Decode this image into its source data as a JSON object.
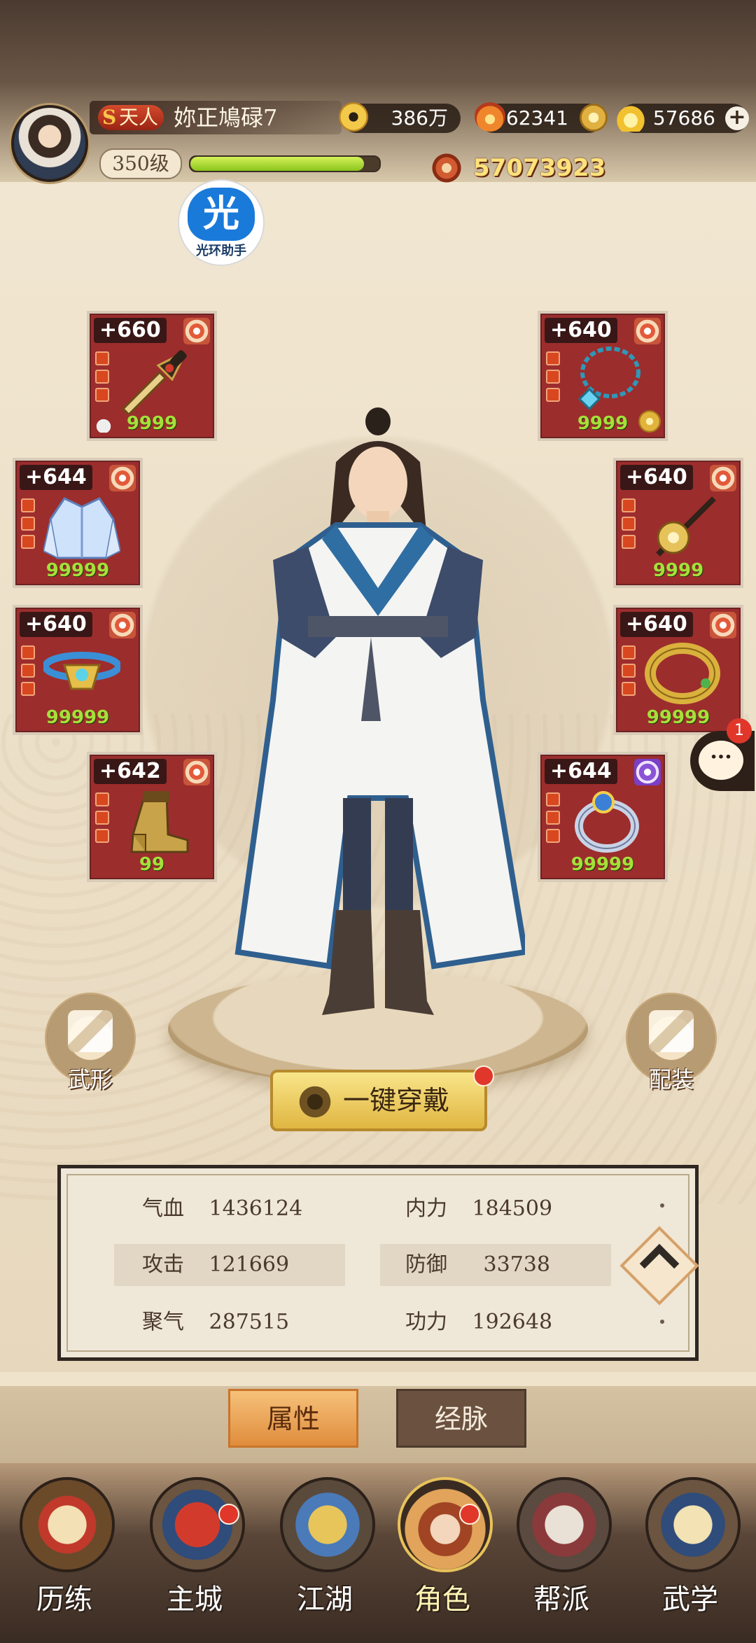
{
  "player": {
    "rank_label": "天人",
    "name": "妳正鳩碌7",
    "level_label": "350级",
    "exp_fraction": 0.92,
    "combat_power": "57073923"
  },
  "currencies": {
    "coins": "386万",
    "flame": "62341",
    "gold": "57686"
  },
  "helper": {
    "glyph": "光",
    "label": "光环助手"
  },
  "equipment": {
    "left": [
      {
        "enhance": "+660",
        "count": "9999",
        "badge": "orange",
        "icon": "dagger-icon",
        "locked": true
      },
      {
        "enhance": "+644",
        "count": "99999",
        "badge": "orange",
        "icon": "robe-icon"
      },
      {
        "enhance": "+640",
        "count": "99999",
        "badge": "orange",
        "icon": "belt-icon"
      },
      {
        "enhance": "+642",
        "count": "99",
        "badge": "orange",
        "icon": "boots-icon"
      }
    ],
    "right": [
      {
        "enhance": "+640",
        "count": "9999",
        "badge": "orange",
        "icon": "necklace-icon",
        "linked": true
      },
      {
        "enhance": "+640",
        "count": "9999",
        "badge": "orange",
        "icon": "hairpin-icon"
      },
      {
        "enhance": "+640",
        "count": "99999",
        "badge": "orange",
        "icon": "bracelet-icon"
      },
      {
        "enhance": "+644",
        "count": "99999",
        "badge": "purple",
        "icon": "ring-icon"
      }
    ]
  },
  "actions": {
    "wuxing": "武形",
    "peizhuang": "配装",
    "equip_all": "一键穿戴"
  },
  "chat": {
    "unread": "1",
    "glyph": "···"
  },
  "stats": {
    "qixue_label": "气血",
    "qixue": "1436124",
    "neili_label": "内力",
    "neili": "184509",
    "gongji_label": "攻击",
    "gongji": "121669",
    "fangyu_label": "防御",
    "fangyu": "33738",
    "juqi_label": "聚气",
    "juqi": "287515",
    "gongli_label": "功力",
    "gongli": "192648"
  },
  "tabs": {
    "attributes": "属性",
    "meridians": "经脉"
  },
  "nav": [
    {
      "label": "历练",
      "icon": "scroll-sword-icon"
    },
    {
      "label": "主城",
      "icon": "castle-gate-icon"
    },
    {
      "label": "江湖",
      "icon": "sword-icon"
    },
    {
      "label": "角色",
      "icon": "character-icon"
    },
    {
      "label": "帮派",
      "icon": "guild-seal-icon"
    },
    {
      "label": "武学",
      "icon": "scrolls-icon"
    }
  ],
  "colors": {
    "slot_red": "#9c2d2d",
    "enhance_green": "#a5e03a",
    "power_gold": "#ffe27a",
    "notify_red": "#e0372a"
  }
}
